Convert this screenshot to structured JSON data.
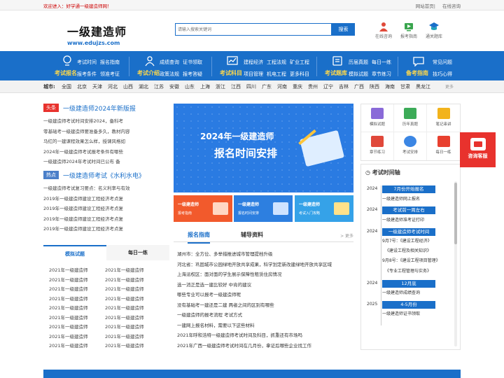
{
  "topbar": {
    "welcome": "欢迎进入：好学通一级建造师网！",
    "links": [
      "网站首页",
      "在线咨询"
    ]
  },
  "logo": {
    "cn": "一级建造师",
    "en": "www.edujzs.com"
  },
  "search": {
    "placeholder": "请输入搜索关键词",
    "button": "搜索"
  },
  "tools": [
    {
      "label": "在线咨询",
      "icon": "user-icon"
    },
    {
      "label": "报考指南",
      "icon": "video-icon"
    },
    {
      "label": "通关题库",
      "icon": "graduation-cap-icon"
    }
  ],
  "nav": [
    {
      "title": "考试报名",
      "icon": "hand-icon",
      "links": [
        "考试时间",
        "报名指南",
        "报考条件",
        "领准考证"
      ]
    },
    {
      "title": "考试介绍",
      "icon": "person-icon",
      "links": [
        "成绩查询",
        "证书领取",
        "政策法规",
        "报考答疑"
      ]
    },
    {
      "title": "考试科目",
      "icon": "chart-icon",
      "links": [
        "建程经济",
        "工程法规",
        "矿业工程",
        "项目管理",
        "机电工程",
        "更多科目"
      ]
    },
    {
      "title": "考试题库",
      "icon": "book-icon",
      "links": [
        "历届真题",
        "每日一练",
        "模拟试题",
        "章节练习"
      ]
    },
    {
      "title": "备考指南",
      "icon": "question-icon",
      "links": [
        "常见问题",
        "技巧心得"
      ]
    }
  ],
  "cities": {
    "label": "城市:",
    "items": [
      "全国",
      "北京",
      "天津",
      "河北",
      "山西",
      "湖北",
      "江苏",
      "安徽",
      "山东",
      "上海",
      "浙江",
      "江西",
      "四川",
      "广东",
      "河南",
      "重庆",
      "贵州",
      "辽宁",
      "吉林",
      "广西",
      "陕西",
      "海南",
      "甘肃",
      "黑龙江"
    ],
    "more": "更多"
  },
  "headline1": {
    "tag": "头条",
    "title": "一级建造师2024年新版报",
    "items": [
      "一级建造师考试时间安排2024，备科考",
      "零基础考一级建造师要准备多久，教材内容",
      "马红的一建课程效果怎么样，授课风格如",
      "2024年一级建造师考试报考条件有哪些",
      "一级建造师2024年考试时间已公布 备"
    ]
  },
  "headline2": {
    "tag": "热点",
    "title": "一级建造师考试《水利水电》",
    "items": [
      "一级建造师考试复习要点：名义利率与有效",
      "2019年一级建造师建设工程经济考点复",
      "2019年一级建造师建设工程经济考点复",
      "2019年一级建造师建设工程经济考点复",
      "2019年一级建造师建设工程经济考点复"
    ]
  },
  "practice": {
    "tabs": [
      "模拟试题",
      "每日一练"
    ],
    "items": [
      "2021年一级建造师",
      "2021年一级建造师",
      "2021年一级建造师",
      "2021年一级建造师",
      "2021年一级建造师",
      "2021年一级建造师",
      "2021年一级建造师",
      "2021年一级建造师",
      "2021年一级建造师",
      "2021年一级建造师",
      "2021年一级建造师",
      "2021年一级建造师",
      "2021年一级建造师",
      "2021年一级建造师",
      "2021年一级建造师",
      "2021年一级建造师",
      "2021年一级建造师",
      "2021年一级建造师"
    ]
  },
  "banner": {
    "line1": "2024年一级建造师",
    "line2": "报名时间安排"
  },
  "minis": [
    {
      "title": "一级建造师",
      "sub": "报考指南",
      "color": "#f25a2c"
    },
    {
      "title": "一级建造师",
      "sub": "报名时间安排",
      "color": "#2d7fe0"
    },
    {
      "title": "一级建造师",
      "sub": "考试入门攻略",
      "color": "#35a2e8"
    }
  ],
  "news": {
    "tabs": [
      "报名指南",
      "辅导资料"
    ],
    "more": "> 更多",
    "items": [
      "湖州市：全方位、多举措推进城市管理提档升级",
      "河北省：巩固城市公园绿地开放共享成果，科学划定新改建绿地开放共享区域",
      "上海派权区：面对面的学生展示保障性租赁住房情况",
      "选一消正是选一建比较好 中肯的建议",
      "哪些专业可以报考一级建造师呢",
      "没有基础考一建还是二建 两者之间的区别有哪些",
      "一级建造师的报考流程 考试方式",
      "一建网上报名材料，需要以下这些材料",
      "2021年呼和浩特一级建造师考试时间及科目，抓重还有市场吗",
      "2021年广西一级建造师考试时间在几月份，拿证后哪些企业找工作"
    ]
  },
  "grid": [
    {
      "label": "模拟试题",
      "color": "#8a6ad8"
    },
    {
      "label": "历年真题",
      "color": "#3cab58"
    },
    {
      "label": "笔记串讲",
      "color": "#f2b31c"
    },
    {
      "label": "章节练习",
      "color": "#e0483a"
    },
    {
      "label": "考试安排",
      "color": "#3b86e4"
    },
    {
      "label": "每日一练",
      "color": "#e8402f"
    }
  ],
  "timeline": {
    "title": "考试时间轴",
    "events": [
      {
        "year": "2024",
        "badge": "7月份开始报名",
        "notes": [
          "一级建造师网上报名"
        ]
      },
      {
        "year": "2024",
        "badge": "考试前一周左右",
        "notes": [
          "一级建造师准考证打印"
        ]
      },
      {
        "year": "2024",
        "badge": "一级建造师考试时间",
        "notes": [
          "9月7号：《建设工程经济》",
          "《建设工程及相关知识》",
          "9月8号：《建设工程项目管理》",
          "《专业工程管理与实务》"
        ]
      },
      {
        "year": "2024",
        "badge": "12月底",
        "notes": [
          "一级建造师成绩查询"
        ]
      },
      {
        "year": "2025",
        "badge": "4-5月份",
        "notes": [
          "一级建造师证书领取"
        ]
      }
    ]
  },
  "consult": {
    "label": "咨询客服"
  }
}
